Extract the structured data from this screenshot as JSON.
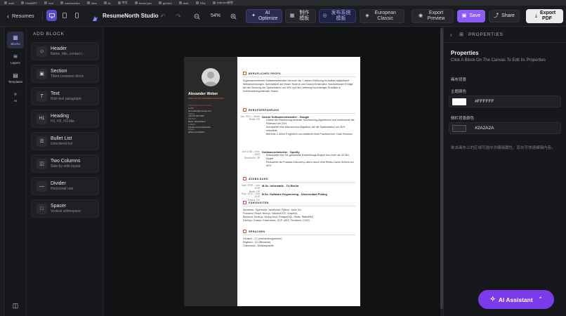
{
  "bookmarks": [
    "mail",
    "ChatGPT",
    "text",
    "bookmarks",
    "idea",
    "AI",
    "中文",
    "found job",
    "gemini",
    "web",
    "TBA",
    "Aiphora研究"
  ],
  "header": {
    "back_label": "Resumes",
    "app_title": "ResumeNorth Studio",
    "zoom": "54%",
    "ai_optimize": "AI Optimize",
    "template_btn": "制作模板",
    "publish_btn": "发布系统模板",
    "style_btn": "European Classic",
    "export_preview": "Export Preview",
    "save": "Save",
    "share": "Share",
    "export_pdf": "Export PDF"
  },
  "rail": [
    {
      "label": "Blocks"
    },
    {
      "label": "Layers"
    },
    {
      "label": "Templates"
    },
    {
      "label": "AI"
    }
  ],
  "blocks_panel": {
    "title": "ADD BLOCK",
    "items": [
      {
        "title": "Header",
        "desc": "Name, title, contact i..."
      },
      {
        "title": "Section",
        "desc": "Titled container block"
      },
      {
        "title": "Text",
        "desc": "Rich text paragraph"
      },
      {
        "title": "Heading",
        "desc": "H1, H2, H3 title"
      },
      {
        "title": "Bullet List",
        "desc": "Unordered list"
      },
      {
        "title": "Two Columns",
        "desc": "Side-by-side layout"
      },
      {
        "title": "Divider",
        "desc": "Horizontal rule"
      },
      {
        "title": "Spacer",
        "desc": "Vertical whitespace"
      }
    ]
  },
  "resume": {
    "name": "Alexander Weber",
    "subtitle": "SENIOR SOFTWAREENTWICKLER",
    "contact_heading": "PERSÖNLICHE DATEN",
    "contact": [
      "E-Mail",
      "alex.weber@example.com",
      "Telefon",
      "+49 170 000 0000",
      "Standort",
      "Berlin, Deutschland",
      "LinkedIn",
      "linkedin.com/in/alexweber",
      "GitHub",
      "github.com/aweber"
    ],
    "profile_title": "BERUFLICHES PROFIL",
    "profile_text": "Ergebnisorientierter Softwareentwickler mit mehr als 7 Jahren Erfahrung im Aufbau skalierbarer Webanwendungen. Spezialisiert auf React, Node.js und Cloud-Infrastruktur. Nachweisbare Erfolge bei der Senkung der Systemlatenz um 40% und der Lieferung hochwertiger Produkte in funktionsübergreifenden Teams.",
    "exp_title": "BERUFSERFAHRUNG",
    "jobs": [
      {
        "date": "Jan. 2021 – Heute",
        "place": "Berlin, DE",
        "role": "Senior Softwareentwickler - Google",
        "bullets": [
          "Leitete die Entwicklung zentraler Suchranking-Algorithmen und verbesserte die Relevanz um 23%",
          "Konzipierte eine Microservice-Migration, die die Systemlatenz um 40% reduzierte",
          "Betreute 4 Junior Engineers und etablierte Best Practices fuer Code Reviews"
        ]
      },
      {
        "date": "Juni 2018 – Dez. 2020",
        "place": "Stockholm, SE",
        "role": "Softwareentwickler - Spotify",
        "bullets": [
          "Entwickelte eine ML-gestuetzte Empfehlungs-Engine fuer mehr als 50 Mio. Nutzer",
          "Reduzierte die Podcast-Discovery-Latenz durch eine Redis-Cache-Schicht um 60%"
        ]
      }
    ],
    "edu_title": "AUSBILDUNG",
    "edu": [
      {
        "date": "Sept. 2016 – Juni 2018",
        "place": "Berlin, DE",
        "degree": "M.Sc. Informatik - TU Berlin"
      },
      {
        "date": "Sept. 2012 – Juni 2016",
        "place": "Peking, CN",
        "degree": "B.Sc. Software Engineering - Universitaet Peking"
      }
    ],
    "skills_title": "FÄHIGKEITEN",
    "skills": [
      "Sprachen: TypeScript, JavaScript, Python, Java, Go",
      "Frontend: React, Next.js, TailwindCSS, GraphQL",
      "Backend: Node.js, Spring Boot, PostgreSQL, Redis, RabbitMQ",
      "DevOps: Docker, Kubernetes, GCP, AWS, Terraform, CI/CD"
    ],
    "lang_title": "SPRACHEN",
    "languages": [
      "Deutsch - C1 (verhandlungssicher)",
      "Englisch - C2 (fliessend)",
      "Chinesisch - Muttersprache"
    ]
  },
  "properties": {
    "header_label": "PROPERTIES",
    "title": "Properties",
    "hint": "Click A Block On The Canvas To Edit Its Properties",
    "page_bg_label": "画布背景",
    "accent_label": "主题颜色",
    "accent_value": "#FFFFFF",
    "sidebar_bg_label": "侧栏背景颜色",
    "sidebar_bg_value": "#2A2A2A",
    "note": "单击画布上的区域可选中并编辑属性。双击可快速编辑内容。"
  },
  "ai_assistant": "AI Assistant",
  "colors": {
    "accent": "#8b5cf6",
    "primary": "#7c3aed",
    "resume_sidebar": "#2A2A2A",
    "resume_accent": "#d04a3a"
  }
}
